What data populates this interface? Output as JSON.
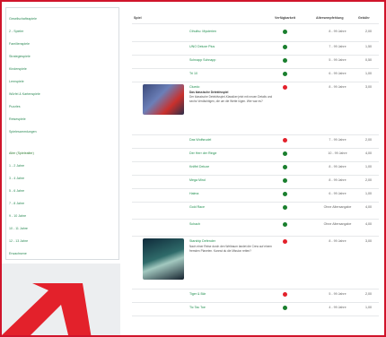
{
  "sidebar": {
    "items": [
      {
        "label": "Gesellschaftsspiele"
      },
      {
        "label": "2 - Spieler"
      },
      {
        "label": "Familienspiele"
      },
      {
        "label": "Strategiespiele"
      },
      {
        "label": "Kinderspiele"
      },
      {
        "label": "Lernspiele"
      },
      {
        "label": "Würfel & Kartenspiele"
      },
      {
        "label": "Puzzles"
      },
      {
        "label": "Reisespiele"
      },
      {
        "label": "Spielesammlungen"
      }
    ],
    "age_heading": "Alter (Spielealter)",
    "age_items": [
      {
        "label": "1 - 2 Jahre"
      },
      {
        "label": "3 - 4 Jahre"
      },
      {
        "label": "5 - 6 Jahre"
      },
      {
        "label": "7 - 8 Jahre"
      },
      {
        "label": "9 - 10 Jahre"
      },
      {
        "label": "10 - 11 Jahre"
      },
      {
        "label": "12 - 13 Jahre"
      },
      {
        "label": "Erwachsene"
      }
    ]
  },
  "table": {
    "headers": {
      "game": "Spiel",
      "availability": "Verfügbarkeit",
      "age": "Altersempfehlung",
      "price": "Gebühr"
    },
    "rows": [
      {
        "title": "Cthulhu: Mysterien",
        "status": "green",
        "age": "8 - 99 Jahre",
        "price": "2,00"
      },
      {
        "title": "UNO Deluxe Plus",
        "status": "green",
        "age": "7 - 99 Jahre",
        "price": "1,50"
      },
      {
        "title": "Schnapp Schnapp",
        "status": "green",
        "age": "5 - 99 Jahre",
        "price": "0,50"
      },
      {
        "title": "Tri 10",
        "status": "green",
        "age": "6 - 99 Jahre",
        "price": "1,00"
      },
      {
        "title": "Cluedo",
        "status": "red",
        "age": "8 - 99 Jahre",
        "price": "3,00",
        "subtitle": "Das klassische Detektivspiel",
        "desc": "Der klassische Detektivspiel-Klassiker jetzt mit neuen Details und sechs Verdächtigen, die um die Wette lügen. Wer war es?",
        "thumb": "cluedo"
      },
      {
        "title": "Das Wolfsrudel",
        "status": "red",
        "age": "7 - 99 Jahre",
        "price": "2,00"
      },
      {
        "title": "Der Herr der Ringe",
        "status": "green",
        "age": "10 - 99 Jahre",
        "price": "4,00"
      },
      {
        "title": "Kniffel Deluxe",
        "status": "green",
        "age": "8 - 99 Jahre",
        "price": "1,00"
      },
      {
        "title": "Mega Mind",
        "status": "green",
        "age": "8 - 99 Jahre",
        "price": "2,00"
      },
      {
        "title": "Halma",
        "status": "green",
        "age": "6 - 99 Jahre",
        "price": "1,00"
      },
      {
        "title": "Gold Race",
        "status": "green",
        "age": "Ohne Altersangabe",
        "price": "4,00"
      },
      {
        "title": "Schach",
        "status": "green",
        "age": "Ohne Altersangabe",
        "price": "4,00"
      },
      {
        "title": "Starship Defender",
        "status": "red",
        "age": "8 - 99 Jahre",
        "price": "3,00",
        "desc": "Nach einer Reise durch den Weltraum landet die Crew auf einem fremden Planeten. Kannst du die Mission retten?",
        "thumb": "space"
      },
      {
        "title": "Tiger & Bär",
        "status": "red",
        "age": "5 - 99 Jahre",
        "price": "2,00"
      },
      {
        "title": "Tic Tac Toe",
        "status": "green",
        "age": "4 - 99 Jahre",
        "price": "1,00"
      }
    ]
  },
  "colors": {
    "accent": "#d0142b",
    "link": "#1f8f4e",
    "available": "#1a7f2e",
    "unavailable": "#e3212b"
  }
}
